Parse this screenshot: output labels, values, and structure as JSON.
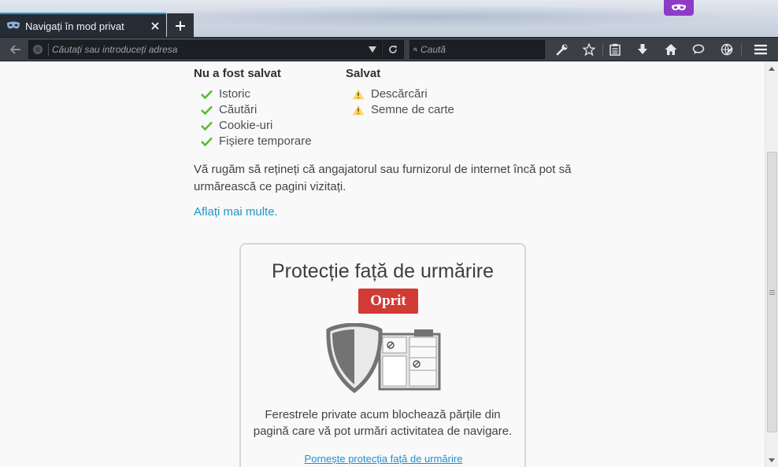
{
  "tab": {
    "title": "Navigați în mod privat"
  },
  "navbar": {
    "url_placeholder": "Căutați sau introduceți adresa",
    "search_placeholder": "Caută"
  },
  "page": {
    "not_saved": {
      "heading": "Nu a fost salvat",
      "items": [
        "Istoric",
        "Căutări",
        "Cookie-uri",
        "Fișiere temporare"
      ]
    },
    "saved": {
      "heading": "Salvat",
      "items": [
        "Descărcări",
        "Semne de carte"
      ]
    },
    "note": "Vă rugăm să rețineți că angajatorul sau furnizorul de internet încă pot să urmărească ce pagini vizitați.",
    "learn_more": "Aflați mai multe.",
    "tracking": {
      "title": "Protecție față de urmărire",
      "status": "Oprit",
      "description": "Ferestrele private acum blochează părțile din pagină care vă pot urmări activitatea de navigare.",
      "enable_link": "Pornește protecția față de urmărire"
    }
  },
  "colors": {
    "accent": "#1f9bdc",
    "check": "#57bd35",
    "warning": "#ffd567",
    "badge_off": "#d13b35",
    "private": "#8e3bc7"
  }
}
